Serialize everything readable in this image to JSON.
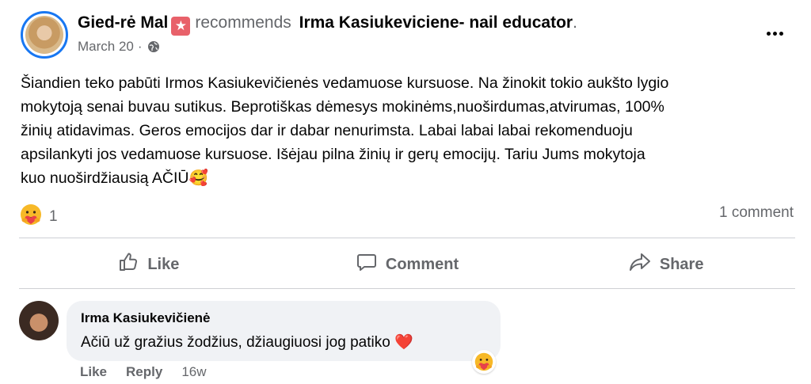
{
  "post": {
    "author": "Gied-rė Mal",
    "recommends_word": "recommends",
    "page_name": "Irma Kasiukeviciene- nail educator",
    "trailing_dot": ".",
    "date": "March 20",
    "date_sep": "·",
    "audience_icon": "globe-icon",
    "badge_icon": "star-icon",
    "text": "Šiandien teko pabūti Irmos Kasiukevičienės vedamuose kursuose. Na žinokit tokio aukšto lygio\nmokytoją senai buvau sutikus. Beprotiškas dėmesys mokinėms,nuoširdumas,atvirumas,  100%\nžinių atidavimas. Geros emocijos dar ir dabar nenurimsta. Labai labai labai rekomenduoju\napsilankyti jos vedamuose kursuose. Išėjau pilna žinių ir gerų emocijų. Tariu Jums mokytoja\nkuo nuoširdžiausią AČIŪ🥰"
  },
  "reactions": {
    "icon": "care-reaction-icon",
    "count": "1",
    "comments_label": "1 comment"
  },
  "actions": {
    "like": "Like",
    "comment": "Comment",
    "share": "Share"
  },
  "comment": {
    "author": "Irma Kasiukevičienė",
    "text": "Ačiū už gražius žodžius, džiaugiuosi jog patiko ❤️",
    "reaction_icon": "care-reaction-icon",
    "like_label": "Like",
    "reply_label": "Reply",
    "age": "16w"
  },
  "colors": {
    "accent": "#1877f2",
    "secondary_text": "#65676b",
    "bubble_bg": "#f0f2f5",
    "badge": "#e8616a"
  }
}
